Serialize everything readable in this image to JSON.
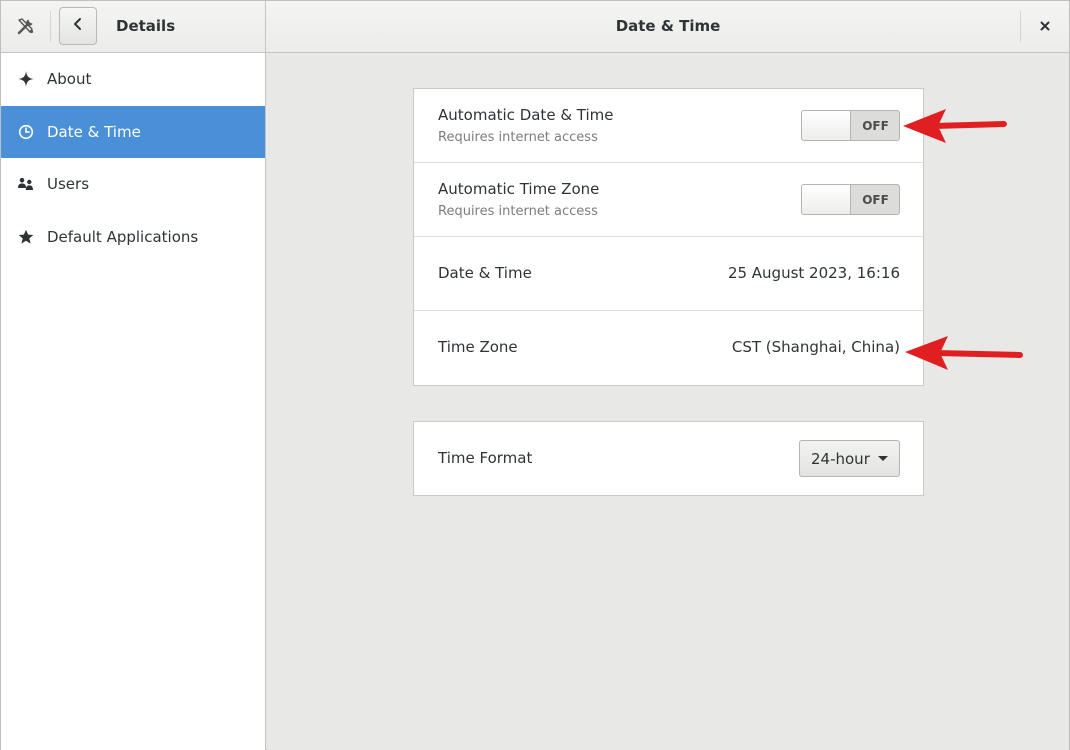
{
  "header": {
    "left_title": "Details",
    "title": "Date & Time",
    "tools_icon": "tools-icon",
    "back_icon": "chevron-left-icon",
    "close_icon": "close-icon"
  },
  "sidebar": {
    "items": [
      {
        "label": "About",
        "icon": "sparkle-icon",
        "active": false
      },
      {
        "label": "Date & Time",
        "icon": "clock-icon",
        "active": true
      },
      {
        "label": "Users",
        "icon": "users-icon",
        "active": false
      },
      {
        "label": "Default Applications",
        "icon": "star-icon",
        "active": false
      }
    ]
  },
  "main": {
    "auto_datetime": {
      "title": "Automatic Date & Time",
      "subtitle": "Requires internet access",
      "switch_state": "OFF"
    },
    "auto_timezone": {
      "title": "Automatic Time Zone",
      "subtitle": "Requires internet access",
      "switch_state": "OFF"
    },
    "datetime": {
      "title": "Date & Time",
      "value": "25 August 2023, 16:16"
    },
    "timezone": {
      "title": "Time Zone",
      "value": "CST (Shanghai, China)"
    },
    "time_format": {
      "title": "Time Format",
      "selected": "24-hour"
    }
  },
  "colors": {
    "accent": "#4a90d9",
    "annotation_arrow": "#e02020"
  }
}
